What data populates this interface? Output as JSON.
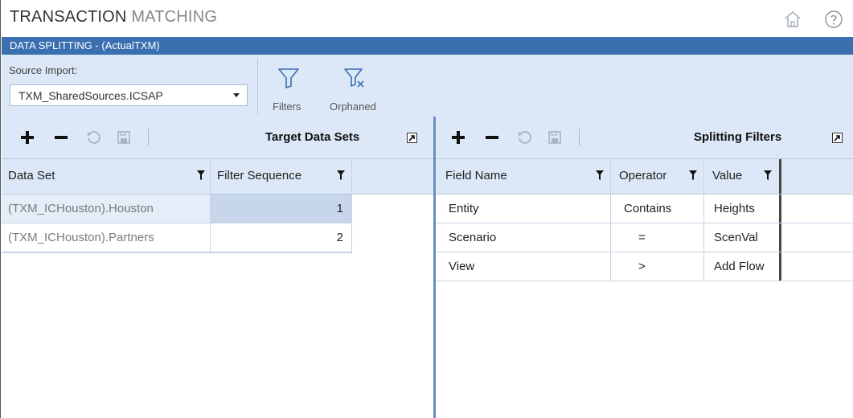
{
  "app": {
    "title_part1": "TRANSACTION",
    "title_part2": "MATCHING",
    "section_title": "DATA SPLITTING - (ActualTXM)"
  },
  "ribbon": {
    "source_import_label": "Source Import:",
    "source_import_value": "TXM_SharedSources.ICSAP",
    "filters_label": "Filters",
    "orphaned_label": "Orphaned"
  },
  "left_pane": {
    "title": "Target Data Sets",
    "columns": [
      "Data Set",
      "Filter Sequence"
    ],
    "rows": [
      {
        "data_set": "(TXM_ICHouston).Houston",
        "filter_sequence": "1",
        "selected": true
      },
      {
        "data_set": "(TXM_ICHouston).Partners",
        "filter_sequence": "2",
        "selected": false
      }
    ]
  },
  "right_pane": {
    "title": "Splitting Filters",
    "columns": [
      "Field Name",
      "Operator",
      "Value"
    ],
    "rows": [
      {
        "field_name": "Entity",
        "operator": "Contains",
        "value": "Heights"
      },
      {
        "field_name": "Scenario",
        "operator": "=",
        "value": "ScenVal"
      },
      {
        "field_name": "View",
        "operator": ">",
        "value": "Add Flow"
      }
    ]
  },
  "icons": {
    "home": "home-icon",
    "help": "help-icon",
    "add": "plus-icon",
    "remove": "minus-icon",
    "refresh": "refresh-icon",
    "save": "save-icon",
    "filter": "funnel-icon",
    "orphaned": "funnel-x-icon",
    "expand": "expand-icon"
  },
  "colors": {
    "header_blue": "#3a6fb0",
    "ribbon_bg": "#dce8f7",
    "selected_row": "#c7d6ea"
  }
}
